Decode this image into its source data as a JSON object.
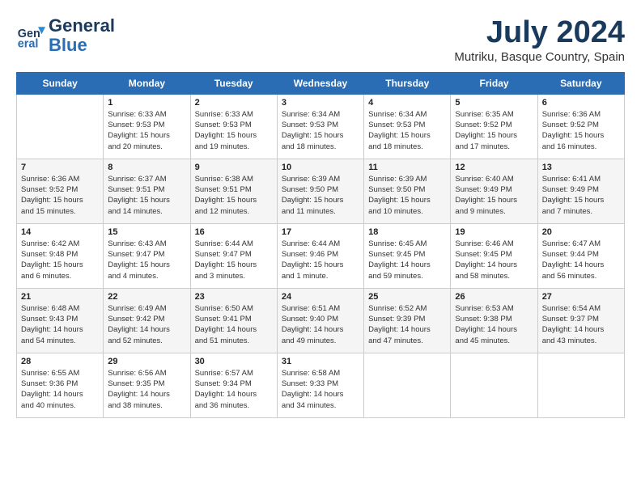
{
  "header": {
    "logo_line1": "General",
    "logo_line2": "Blue",
    "month_year": "July 2024",
    "location": "Mutriku, Basque Country, Spain"
  },
  "days_of_week": [
    "Sunday",
    "Monday",
    "Tuesday",
    "Wednesday",
    "Thursday",
    "Friday",
    "Saturday"
  ],
  "weeks": [
    [
      {
        "day": "",
        "content": ""
      },
      {
        "day": "1",
        "content": "Sunrise: 6:33 AM\nSunset: 9:53 PM\nDaylight: 15 hours\nand 20 minutes."
      },
      {
        "day": "2",
        "content": "Sunrise: 6:33 AM\nSunset: 9:53 PM\nDaylight: 15 hours\nand 19 minutes."
      },
      {
        "day": "3",
        "content": "Sunrise: 6:34 AM\nSunset: 9:53 PM\nDaylight: 15 hours\nand 18 minutes."
      },
      {
        "day": "4",
        "content": "Sunrise: 6:34 AM\nSunset: 9:53 PM\nDaylight: 15 hours\nand 18 minutes."
      },
      {
        "day": "5",
        "content": "Sunrise: 6:35 AM\nSunset: 9:52 PM\nDaylight: 15 hours\nand 17 minutes."
      },
      {
        "day": "6",
        "content": "Sunrise: 6:36 AM\nSunset: 9:52 PM\nDaylight: 15 hours\nand 16 minutes."
      }
    ],
    [
      {
        "day": "7",
        "content": "Sunrise: 6:36 AM\nSunset: 9:52 PM\nDaylight: 15 hours\nand 15 minutes."
      },
      {
        "day": "8",
        "content": "Sunrise: 6:37 AM\nSunset: 9:51 PM\nDaylight: 15 hours\nand 14 minutes."
      },
      {
        "day": "9",
        "content": "Sunrise: 6:38 AM\nSunset: 9:51 PM\nDaylight: 15 hours\nand 12 minutes."
      },
      {
        "day": "10",
        "content": "Sunrise: 6:39 AM\nSunset: 9:50 PM\nDaylight: 15 hours\nand 11 minutes."
      },
      {
        "day": "11",
        "content": "Sunrise: 6:39 AM\nSunset: 9:50 PM\nDaylight: 15 hours\nand 10 minutes."
      },
      {
        "day": "12",
        "content": "Sunrise: 6:40 AM\nSunset: 9:49 PM\nDaylight: 15 hours\nand 9 minutes."
      },
      {
        "day": "13",
        "content": "Sunrise: 6:41 AM\nSunset: 9:49 PM\nDaylight: 15 hours\nand 7 minutes."
      }
    ],
    [
      {
        "day": "14",
        "content": "Sunrise: 6:42 AM\nSunset: 9:48 PM\nDaylight: 15 hours\nand 6 minutes."
      },
      {
        "day": "15",
        "content": "Sunrise: 6:43 AM\nSunset: 9:47 PM\nDaylight: 15 hours\nand 4 minutes."
      },
      {
        "day": "16",
        "content": "Sunrise: 6:44 AM\nSunset: 9:47 PM\nDaylight: 15 hours\nand 3 minutes."
      },
      {
        "day": "17",
        "content": "Sunrise: 6:44 AM\nSunset: 9:46 PM\nDaylight: 15 hours\nand 1 minute."
      },
      {
        "day": "18",
        "content": "Sunrise: 6:45 AM\nSunset: 9:45 PM\nDaylight: 14 hours\nand 59 minutes."
      },
      {
        "day": "19",
        "content": "Sunrise: 6:46 AM\nSunset: 9:45 PM\nDaylight: 14 hours\nand 58 minutes."
      },
      {
        "day": "20",
        "content": "Sunrise: 6:47 AM\nSunset: 9:44 PM\nDaylight: 14 hours\nand 56 minutes."
      }
    ],
    [
      {
        "day": "21",
        "content": "Sunrise: 6:48 AM\nSunset: 9:43 PM\nDaylight: 14 hours\nand 54 minutes."
      },
      {
        "day": "22",
        "content": "Sunrise: 6:49 AM\nSunset: 9:42 PM\nDaylight: 14 hours\nand 52 minutes."
      },
      {
        "day": "23",
        "content": "Sunrise: 6:50 AM\nSunset: 9:41 PM\nDaylight: 14 hours\nand 51 minutes."
      },
      {
        "day": "24",
        "content": "Sunrise: 6:51 AM\nSunset: 9:40 PM\nDaylight: 14 hours\nand 49 minutes."
      },
      {
        "day": "25",
        "content": "Sunrise: 6:52 AM\nSunset: 9:39 PM\nDaylight: 14 hours\nand 47 minutes."
      },
      {
        "day": "26",
        "content": "Sunrise: 6:53 AM\nSunset: 9:38 PM\nDaylight: 14 hours\nand 45 minutes."
      },
      {
        "day": "27",
        "content": "Sunrise: 6:54 AM\nSunset: 9:37 PM\nDaylight: 14 hours\nand 43 minutes."
      }
    ],
    [
      {
        "day": "28",
        "content": "Sunrise: 6:55 AM\nSunset: 9:36 PM\nDaylight: 14 hours\nand 40 minutes."
      },
      {
        "day": "29",
        "content": "Sunrise: 6:56 AM\nSunset: 9:35 PM\nDaylight: 14 hours\nand 38 minutes."
      },
      {
        "day": "30",
        "content": "Sunrise: 6:57 AM\nSunset: 9:34 PM\nDaylight: 14 hours\nand 36 minutes."
      },
      {
        "day": "31",
        "content": "Sunrise: 6:58 AM\nSunset: 9:33 PM\nDaylight: 14 hours\nand 34 minutes."
      },
      {
        "day": "",
        "content": ""
      },
      {
        "day": "",
        "content": ""
      },
      {
        "day": "",
        "content": ""
      }
    ]
  ]
}
